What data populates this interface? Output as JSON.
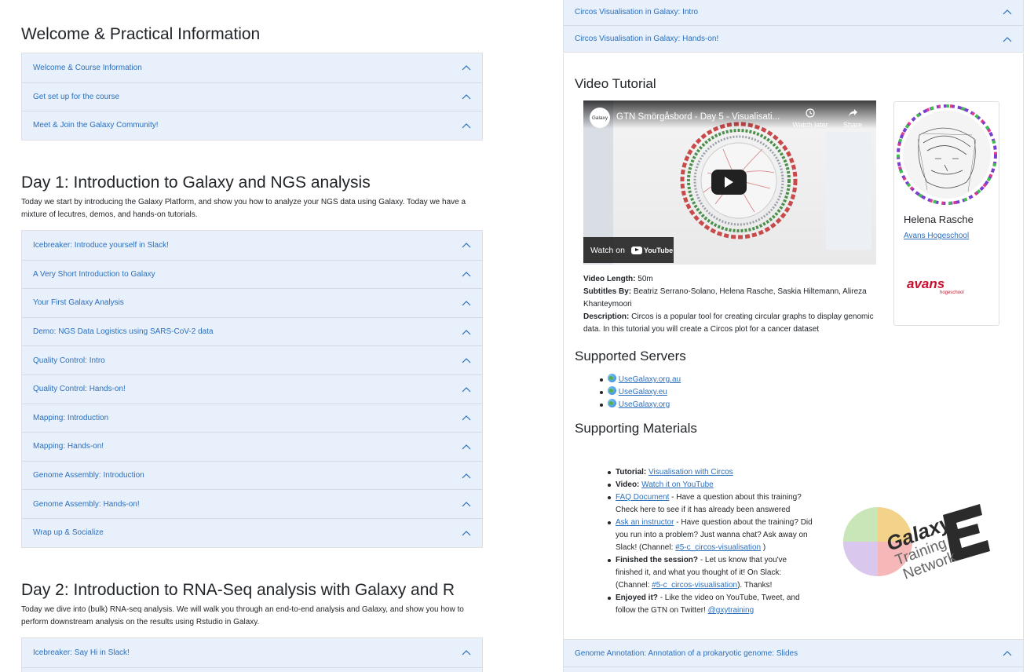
{
  "left": {
    "sections": [
      {
        "title": "Welcome & Practical Information",
        "intro": "",
        "items": [
          "Welcome & Course Information",
          "Get set up for the course",
          "Meet & Join the Galaxy Community!"
        ]
      },
      {
        "title": "Day 1: Introduction to Galaxy and NGS analysis",
        "intro": "Today we start by introducing the Galaxy Platform, and show you how to analyze your NGS data using Galaxy. Today we have a mixture of lecutres, demos, and hands-on tutorials.",
        "items": [
          "Icebreaker: Introduce yourself in Slack!",
          "A Very Short Introduction to Galaxy",
          "Your First Galaxy Analysis",
          "Demo: NGS Data Logistics using SARS-CoV-2 data",
          "Quality Control: Intro",
          "Quality Control: Hands-on!",
          "Mapping: Introduction",
          "Mapping: Hands-on!",
          "Genome Assembly: Introduction",
          "Genome Assembly: Hands-on!",
          "Wrap up & Socialize"
        ]
      },
      {
        "title": "Day 2: Introduction to RNA-Seq analysis with Galaxy and R",
        "intro": "Today we dive into (bulk) RNA-seq analysis. We will walk you through an end-to-end analysis and Galaxy, and show you how to perform downstream analysis on the results using Rstudio in Galaxy.",
        "items": [
          "Icebreaker: Say Hi in Slack!"
        ]
      }
    ]
  },
  "right": {
    "top_items": [
      "Circos Visualisation in Galaxy: Intro",
      "Circos Visualisation in Galaxy: Hands-on!"
    ],
    "video_heading": "Video Tutorial",
    "video": {
      "title": "GTN Smörgåsbord - Day 5 - Visualisati...",
      "watch_label": "Watch on",
      "youtube_label": "YouTube",
      "watch_later": "Watch later",
      "share": "Share",
      "logo_text": "Galaxy"
    },
    "meta": {
      "length_label": "Video Length:",
      "length_value": "50m",
      "subtitles_label": "Subtitles By:",
      "subtitles_value": "Beatriz Serrano-Solano, Helena Rasche, Saskia Hiltemann, Alireza Khanteymoori",
      "description_label": "Description:",
      "description_value": "Circos is a popular tool for creating circular graphs to display genomic data. In this tutorial you will create a Circos plot for a cancer dataset"
    },
    "author": {
      "name": "Helena Rasche",
      "affiliation": "Avans Hogeschool",
      "logo_text": "avans",
      "logo_sub": "hogeschool"
    },
    "servers_heading": "Supported Servers",
    "servers": [
      "UseGalaxy.org.au",
      "UseGalaxy.eu",
      "UseGalaxy.org"
    ],
    "materials_heading": "Supporting Materials",
    "materials": {
      "tutorial_label": "Tutorial:",
      "tutorial_link": "Visualisation with Circos",
      "video_label": "Video:",
      "video_link": "Watch it on YouTube",
      "faq_link": "FAQ Document",
      "faq_text": "- Have a question about this training? Check here to see if it has already been answered",
      "ask_link": "Ask an instructor",
      "ask_text_1": "- Have question about the training? Did you run into a problem? Just wanna chat? Ask away on Slack! (Channel:",
      "ask_channel": "#5-c_circos-visualisation",
      "ask_text_2": ")",
      "finished_label": "Finished the session?",
      "finished_text_1": "- Let us know that you've finished it, and what you thought of it! On Slack: (Channel:",
      "finished_channel": "#5-c_circos-visualisation",
      "finished_text_2": "). Thanks!",
      "enjoyed_label": "Enjoyed it?",
      "enjoyed_text": "- Like the video on YouTube, Tweet, and follow the GTN on Twitter!",
      "enjoyed_link": "@gxytraining"
    },
    "gtn_logo": {
      "line1": "Galaxy",
      "line2": "Training",
      "line3": "Network"
    },
    "bottom_items": [
      "Genome Annotation: Annotation of a prokaryotic genome: Slides"
    ]
  },
  "colors": {
    "accent": "#2c6fbd",
    "accordion_bg": "#e8f0fb",
    "border": "#dfdfdf"
  },
  "icons": {
    "accordion": "chevron-up-icon",
    "server": "globe-icon"
  }
}
